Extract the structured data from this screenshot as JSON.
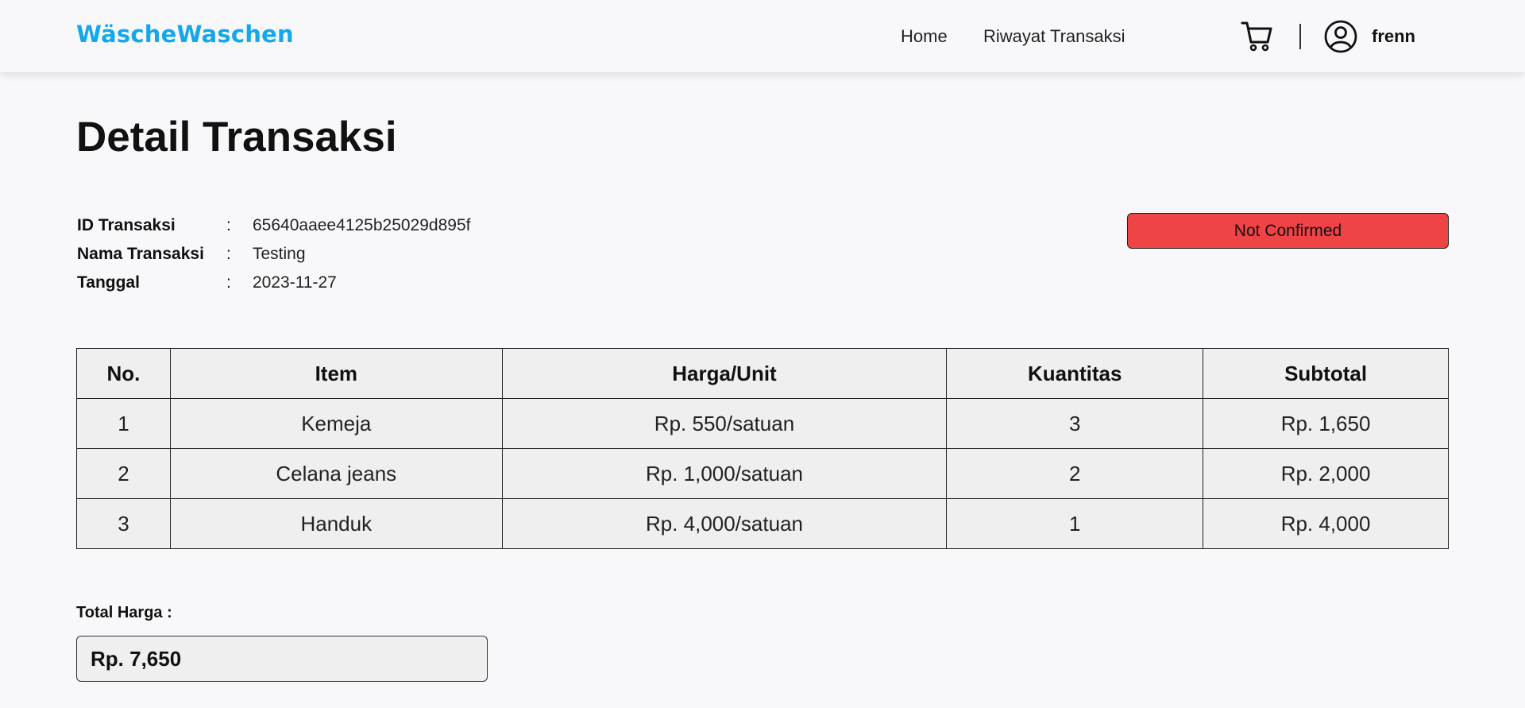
{
  "brand": "WäscheWaschen",
  "nav": {
    "home": "Home",
    "history": "Riwayat Transaksi",
    "cart_icon": "cart-icon",
    "user_icon": "user-circle-icon",
    "username": "frenn"
  },
  "page_title": "Detail Transaksi",
  "info": [
    {
      "label": "ID Transaksi",
      "colon": ":",
      "value": "65640aaee4125b25029d895f"
    },
    {
      "label": "Nama Transaksi",
      "colon": ":",
      "value": "Testing"
    },
    {
      "label": "Tanggal",
      "colon": ":",
      "value": "2023-11-27"
    }
  ],
  "status": {
    "label": "Not Confirmed",
    "color": "#ef4346"
  },
  "table": {
    "headers": [
      "No.",
      "Item",
      "Harga/Unit",
      "Kuantitas",
      "Subtotal"
    ],
    "rows": [
      [
        "1",
        "Kemeja",
        "Rp. 550/satuan",
        "3",
        "Rp. 1,650"
      ],
      [
        "2",
        "Celana jeans",
        "Rp. 1,000/satuan",
        "2",
        "Rp. 2,000"
      ],
      [
        "3",
        "Handuk",
        "Rp. 4,000/satuan",
        "1",
        "Rp. 4,000"
      ]
    ]
  },
  "total": {
    "label": "Total Harga :",
    "value": "Rp. 7,650"
  },
  "colors": {
    "brand": "#14a7ea",
    "background": "#f8f8fa",
    "table_bg": "#efefef"
  }
}
